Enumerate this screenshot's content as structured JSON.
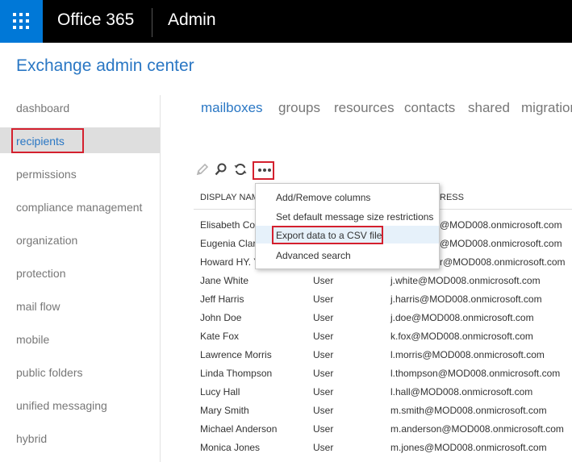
{
  "topbar": {
    "brand": "Office 365",
    "app": "Admin"
  },
  "page_title": "Exchange admin center",
  "nav": {
    "items": [
      {
        "label": "dashboard",
        "active": false
      },
      {
        "label": "recipients",
        "active": true
      },
      {
        "label": "permissions",
        "active": false
      },
      {
        "label": "compliance management",
        "active": false
      },
      {
        "label": "organization",
        "active": false
      },
      {
        "label": "protection",
        "active": false
      },
      {
        "label": "mail flow",
        "active": false
      },
      {
        "label": "mobile",
        "active": false
      },
      {
        "label": "public folders",
        "active": false
      },
      {
        "label": "unified messaging",
        "active": false
      },
      {
        "label": "hybrid",
        "active": false
      }
    ]
  },
  "tabs": [
    {
      "label": "mailboxes",
      "active": true
    },
    {
      "label": "groups",
      "active": false
    },
    {
      "label": "resources",
      "active": false
    },
    {
      "label": "contacts",
      "active": false
    },
    {
      "label": "shared",
      "active": false
    },
    {
      "label": "migration",
      "active": false
    }
  ],
  "toolbar": {
    "edit_icon": "pencil-icon",
    "search_icon": "search-icon",
    "refresh_icon": "refresh-icon",
    "more_icon": "more-icon"
  },
  "table": {
    "headers": {
      "display_name": "DISPLAY NAM",
      "email": "RESS"
    },
    "rows": [
      {
        "name": "Elisabeth Cor",
        "type": "",
        "email": "@MOD008.onmicrosoft.com"
      },
      {
        "name": "Eugenia Clark",
        "type": "",
        "email": "@MOD008.onmicrosoft.com"
      },
      {
        "name": "Howard HY. Y",
        "type": "",
        "email": "r@MOD008.onmicrosoft.com"
      },
      {
        "name": "Jane White",
        "type": "User",
        "email": "j.white@MOD008.onmicrosoft.com"
      },
      {
        "name": "Jeff Harris",
        "type": "User",
        "email": "j.harris@MOD008.onmicrosoft.com"
      },
      {
        "name": "John Doe",
        "type": "User",
        "email": "j.doe@MOD008.onmicrosoft.com"
      },
      {
        "name": "Kate Fox",
        "type": "User",
        "email": "k.fox@MOD008.onmicrosoft.com"
      },
      {
        "name": "Lawrence Morris",
        "type": "User",
        "email": "l.morris@MOD008.onmicrosoft.com"
      },
      {
        "name": "Linda Thompson",
        "type": "User",
        "email": "l.thompson@MOD008.onmicrosoft.com"
      },
      {
        "name": "Lucy Hall",
        "type": "User",
        "email": "l.hall@MOD008.onmicrosoft.com"
      },
      {
        "name": "Mary Smith",
        "type": "User",
        "email": "m.smith@MOD008.onmicrosoft.com"
      },
      {
        "name": "Michael Anderson",
        "type": "User",
        "email": "m.anderson@MOD008.onmicrosoft.com"
      },
      {
        "name": "Monica Jones",
        "type": "User",
        "email": "m.jones@MOD008.onmicrosoft.com"
      }
    ]
  },
  "more_menu": {
    "items": [
      {
        "label": "Add/Remove columns"
      },
      {
        "label": "Set default message size restrictions"
      },
      {
        "label": "Export data to a CSV file",
        "highlighted": true
      },
      {
        "label": "Advanced search"
      }
    ]
  },
  "colors": {
    "accent": "#2a77c4",
    "highlight_box": "#d4202e",
    "waffle": "#0078d7"
  }
}
